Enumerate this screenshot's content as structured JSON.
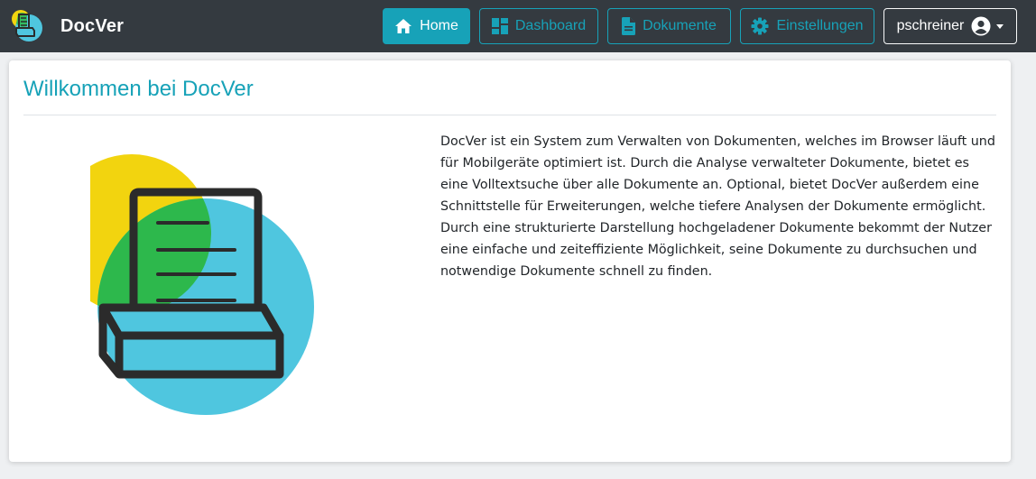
{
  "app": {
    "name": "DocVer"
  },
  "nav": {
    "items": [
      {
        "label": "Home",
        "icon": "home-icon",
        "active": true
      },
      {
        "label": "Dashboard",
        "icon": "dashboard-icon",
        "active": false
      },
      {
        "label": "Dokumente",
        "icon": "document-icon",
        "active": false
      },
      {
        "label": "Einstellungen",
        "icon": "gear-icon",
        "active": false
      }
    ],
    "user": {
      "name": "pschreiner",
      "icon": "user-circle-icon"
    }
  },
  "main": {
    "title": "Willkommen bei DocVer",
    "intro": "DocVer ist ein System zum Verwalten von Dokumenten, welches im Browser läuft und für Mobilgeräte optimiert ist. Durch die Analyse verwalteter Dokumente, bietet es eine Volltextsuche über alle Dokumente an. Optional, bietet DocVer außerdem eine Schnittstelle für Erweiterungen, welche tiefere Analysen der Dokumente ermöglicht. Durch eine strukturierte Darstellung hochgeladener Dokumente bekommt der Nutzer eine einfache und zeiteffiziente Möglichkeit, seine Dokumente zu durchsuchen und notwendige Dokumente schnell zu finden.",
    "illustration": "document-tray-illustration"
  },
  "colors": {
    "navbar_bg": "#343a40",
    "accent": "#17a2b8",
    "yellow": "#f2d40f",
    "cyan": "#4fc6df",
    "green": "#2db84c",
    "ink": "#2b2b2b"
  }
}
